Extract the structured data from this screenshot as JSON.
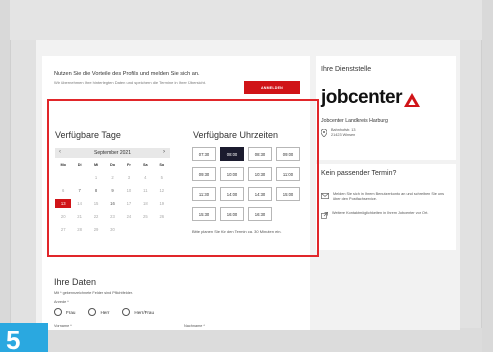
{
  "login": {
    "heading": "Nutzen Sie die Vorteile des Profils und melden Sie sich an.",
    "subtext": "Wir übernehmen Ihre hinterlegten Daten und speichern die Termine in Ihrer Übersicht.",
    "button": "ANMELDEN"
  },
  "days": {
    "title": "Verfügbare Tage",
    "month": "September 2021",
    "prev": "‹",
    "next": "›",
    "weekdays": [
      "Mo",
      "Di",
      "Mi",
      "Do",
      "Fr",
      "Sa",
      "So"
    ],
    "cells": [
      {
        "t": "",
        "s": ""
      },
      {
        "t": "",
        "s": ""
      },
      {
        "t": "1",
        "s": ""
      },
      {
        "t": "2",
        "s": ""
      },
      {
        "t": "3",
        "s": ""
      },
      {
        "t": "4",
        "s": ""
      },
      {
        "t": "5",
        "s": ""
      },
      {
        "t": "6",
        "s": ""
      },
      {
        "t": "7",
        "s": "on"
      },
      {
        "t": "8",
        "s": "on"
      },
      {
        "t": "9",
        "s": "on"
      },
      {
        "t": "10",
        "s": ""
      },
      {
        "t": "11",
        "s": ""
      },
      {
        "t": "12",
        "s": ""
      },
      {
        "t": "13",
        "s": "sel"
      },
      {
        "t": "14",
        "s": ""
      },
      {
        "t": "15",
        "s": ""
      },
      {
        "t": "16",
        "s": "on"
      },
      {
        "t": "17",
        "s": ""
      },
      {
        "t": "18",
        "s": ""
      },
      {
        "t": "19",
        "s": ""
      },
      {
        "t": "20",
        "s": ""
      },
      {
        "t": "21",
        "s": ""
      },
      {
        "t": "22",
        "s": ""
      },
      {
        "t": "23",
        "s": ""
      },
      {
        "t": "24",
        "s": ""
      },
      {
        "t": "25",
        "s": ""
      },
      {
        "t": "26",
        "s": ""
      },
      {
        "t": "27",
        "s": ""
      },
      {
        "t": "28",
        "s": ""
      },
      {
        "t": "29",
        "s": ""
      },
      {
        "t": "30",
        "s": ""
      },
      {
        "t": "",
        "s": ""
      },
      {
        "t": "",
        "s": ""
      },
      {
        "t": "",
        "s": ""
      }
    ]
  },
  "times": {
    "title": "Verfügbare Uhrzeiten",
    "slots": [
      {
        "t": "07:30",
        "s": ""
      },
      {
        "t": "08:00",
        "s": "sel"
      },
      {
        "t": "08:30",
        "s": ""
      },
      {
        "t": "09:00",
        "s": ""
      },
      {
        "t": "09:30",
        "s": ""
      },
      {
        "t": "10:00",
        "s": ""
      },
      {
        "t": "10:30",
        "s": ""
      },
      {
        "t": "11:00",
        "s": ""
      },
      {
        "t": "11:30",
        "s": ""
      },
      {
        "t": "14:00",
        "s": ""
      },
      {
        "t": "14:30",
        "s": ""
      },
      {
        "t": "15:00",
        "s": ""
      },
      {
        "t": "15:30",
        "s": ""
      },
      {
        "t": "16:00",
        "s": ""
      },
      {
        "t": "16:30",
        "s": ""
      }
    ],
    "note": "Bitte planen Sie für den Termin ca. 30 Minuten ein."
  },
  "form": {
    "title": "Ihre Daten",
    "required_note": "Mit * gekennzeichnete Felder sind Pflichtfelder.",
    "anrede_label": "Anrede *",
    "options": [
      "Frau",
      "Herr",
      "Herr/Frau"
    ],
    "vorname_label": "Vorname *",
    "nachname_label": "Nachname *"
  },
  "dienststelle": {
    "heading": "Ihre Dienststelle",
    "logo_text": "jobcenter",
    "name": "Jobcenter Landkreis Harburg",
    "street": "Bahnhofstr. 13",
    "city": "21423 Winsen"
  },
  "kein_termin": {
    "heading": "Kein passender Termin?",
    "item1": "Melden Sie sich in Ihrem Benutzerkonto an und schreiben Sie uns über den Postfachservice.",
    "item2": "Weitere Kontaktmöglichkeiten in Ihrem Jobcenter vor Ort."
  },
  "step_number": "5",
  "colors": {
    "accent": "#d01418",
    "selected_slot": "#1b1b2e",
    "highlight": "#e1262a",
    "step_badge": "#2aa8e0"
  }
}
